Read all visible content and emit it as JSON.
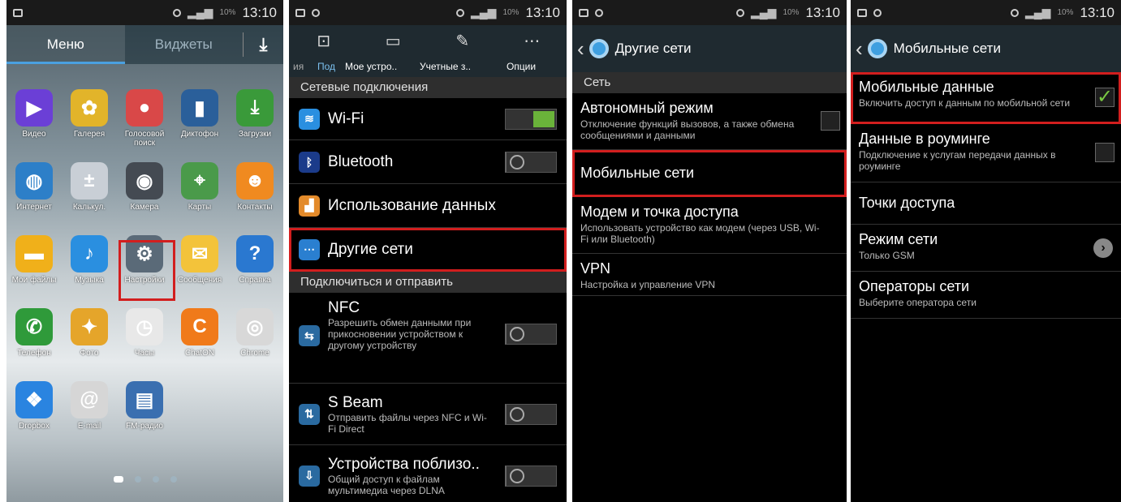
{
  "status_time": "13:10",
  "status_battery": "10%",
  "panel1": {
    "tabs": [
      "Меню",
      "Виджеты"
    ],
    "apps": [
      {
        "label": "Видео",
        "icon": "play-icon",
        "color": "#6b3fd6"
      },
      {
        "label": "Галерея",
        "icon": "gallery-icon",
        "color": "#e2b42a"
      },
      {
        "label": "Голосовой поиск",
        "icon": "mic-icon",
        "color": "#d94848"
      },
      {
        "label": "Диктофон",
        "icon": "recorder-icon",
        "color": "#2a5f9a"
      },
      {
        "label": "Загрузки",
        "icon": "download-icon",
        "color": "#3a9a3a"
      },
      {
        "label": "Интернет",
        "icon": "globe-icon",
        "color": "#2d7fc8"
      },
      {
        "label": "Калькул.",
        "icon": "calculator-icon",
        "color": "#c9cfd6"
      },
      {
        "label": "Камера",
        "icon": "camera-icon",
        "color": "#444a52"
      },
      {
        "label": "Карты",
        "icon": "maps-icon",
        "color": "#4a9a4a"
      },
      {
        "label": "Контакты",
        "icon": "contacts-icon",
        "color": "#f08a20"
      },
      {
        "label": "Мои файлы",
        "icon": "folder-icon",
        "color": "#f0b01a"
      },
      {
        "label": "Музыка",
        "icon": "music-icon",
        "color": "#2a8fe0"
      },
      {
        "label": "Настройки",
        "icon": "settings-icon",
        "color": "#5a6a78"
      },
      {
        "label": "Сообщения",
        "icon": "message-icon",
        "color": "#f3c33a"
      },
      {
        "label": "Справка",
        "icon": "help-icon",
        "color": "#2a78d0"
      },
      {
        "label": "Телефон",
        "icon": "phone-icon",
        "color": "#2f9a3a"
      },
      {
        "label": "Фото",
        "icon": "photos-icon",
        "color": "#e5a52a"
      },
      {
        "label": "Часы",
        "icon": "clock-icon",
        "color": "#e8e8e8"
      },
      {
        "label": "ChatON",
        "icon": "chaton-icon",
        "color": "#f07a1a"
      },
      {
        "label": "Chrome",
        "icon": "chrome-icon",
        "color": "#d8d8d8"
      },
      {
        "label": "Dropbox",
        "icon": "dropbox-icon",
        "color": "#2a84e0"
      },
      {
        "label": "E-mail",
        "icon": "email-icon",
        "color": "#d6d6d6"
      },
      {
        "label": "FM-радио",
        "icon": "radio-icon",
        "color": "#3a6fb0"
      }
    ]
  },
  "panel2": {
    "tab_labels": [
      "ия",
      "Под",
      "Мое устро..",
      "Учетные з..",
      "Опции"
    ],
    "section1": "Сетевые подключения",
    "wifi": "Wi-Fi",
    "bluetooth": "Bluetooth",
    "data_usage": "Использование данных",
    "other_networks": "Другие сети",
    "section2": "Подключиться и отправить",
    "nfc": {
      "title": "NFC",
      "sub": "Разрешить обмен данными при прикосновении устройством к другому устройству"
    },
    "sbeam": {
      "title": "S Beam",
      "sub": "Отправить файлы через NFC и Wi-Fi Direct"
    },
    "nearby": {
      "title": "Устройства поблизо..",
      "sub": "Общий доступ к файлам мультимедиа через DLNA"
    },
    "switches": {
      "wifi": "on",
      "bluetooth": "off",
      "nfc": "off",
      "sbeam": "off",
      "nearby": "off"
    }
  },
  "panel3": {
    "title": "Другие сети",
    "section": "Сеть",
    "items": [
      {
        "title": "Автономный режим",
        "sub": "Отключение функций вызовов, а также обмена сообщениями и данными"
      },
      {
        "title": "Мобильные сети",
        "sub": ""
      },
      {
        "title": "Модем и точка доступа",
        "sub": "Использовать устройство как модем (через USB, Wi-Fi или Bluetooth)"
      },
      {
        "title": "VPN",
        "sub": "Настройка и управление VPN"
      }
    ]
  },
  "panel4": {
    "title": "Мобильные сети",
    "items": [
      {
        "title": "Мобильные данные",
        "sub": "Включить доступ к данным по мобильной сети",
        "check": "on"
      },
      {
        "title": "Данные в роуминге",
        "sub": "Подключение к услугам передачи данных в роуминге",
        "check": "off"
      },
      {
        "title": "Точки доступа",
        "sub": ""
      },
      {
        "title": "Режим сети",
        "sub": "Только GSM"
      },
      {
        "title": "Операторы сети",
        "sub": "Выберите оператора сети"
      }
    ]
  }
}
